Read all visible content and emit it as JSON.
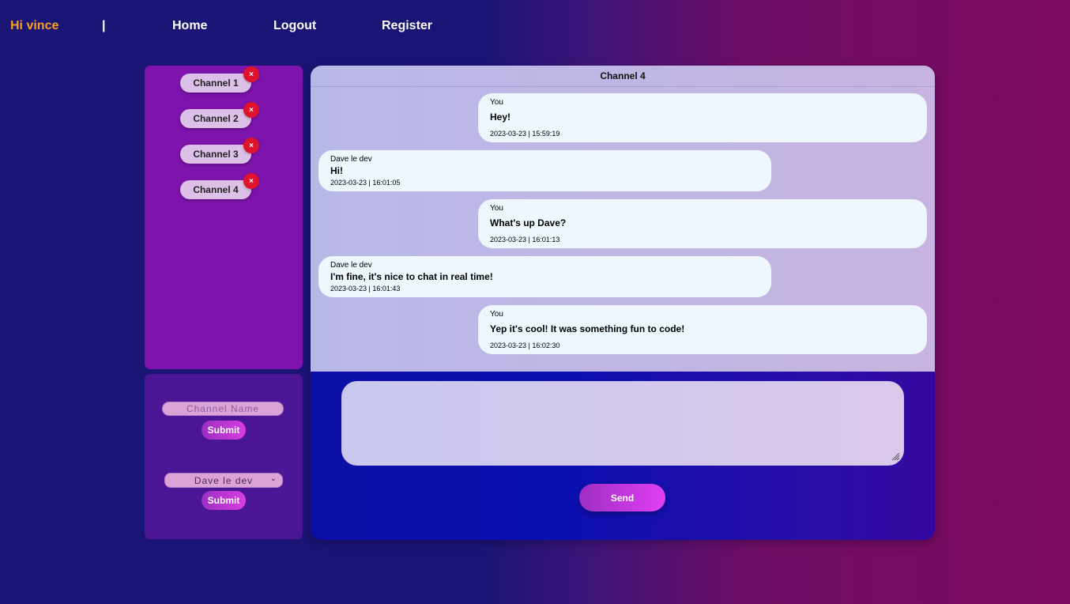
{
  "nav": {
    "greeting": "Hi vince",
    "separator": "|",
    "home": "Home",
    "logout": "Logout",
    "register": "Register"
  },
  "channels": [
    {
      "label": "Channel 1"
    },
    {
      "label": "Channel 2"
    },
    {
      "label": "Channel 3"
    },
    {
      "label": "Channel 4"
    }
  ],
  "close_symbol": "×",
  "forms": {
    "channel_name_placeholder": "Channel Name",
    "submit_label": "Submit",
    "user_select_value": "Dave le dev",
    "chevron": "⌄"
  },
  "chat": {
    "title": "Channel 4",
    "messages": [
      {
        "author": "You",
        "text": "Hey!",
        "time": "2023-03-23 | 15:59:19"
      },
      {
        "author": "Dave le dev",
        "text": "Hi!",
        "time": "2023-03-23 | 16:01:05"
      },
      {
        "author": "You",
        "text": "What's up Dave?",
        "time": "2023-03-23 | 16:01:13"
      },
      {
        "author": "Dave le dev",
        "text": "I'm fine, it's nice to chat in real time!",
        "time": "2023-03-23 | 16:01:43"
      },
      {
        "author": "You",
        "text": "Yep it's cool! It was something fun to code!",
        "time": "2023-03-23 | 16:02:30"
      }
    ],
    "message_value": "",
    "send_label": "Send"
  }
}
